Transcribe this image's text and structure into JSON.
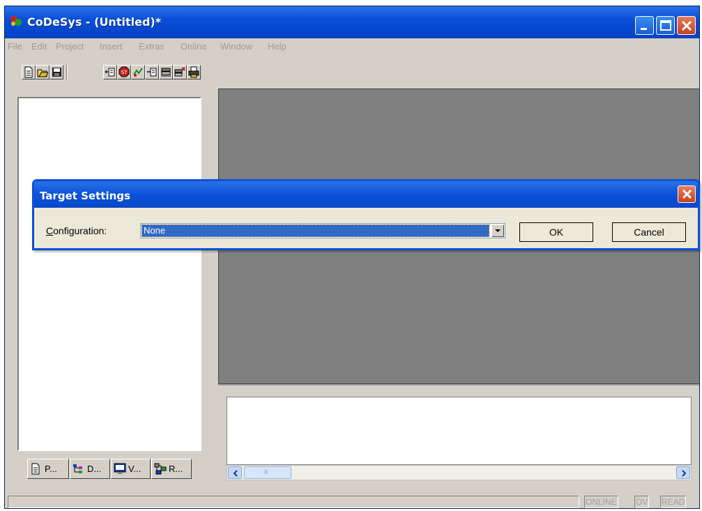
{
  "window": {
    "title": "CoDeSys - (Untitled)*"
  },
  "menu": [
    "File",
    "Edit",
    "Project",
    "Insert",
    "Extras",
    "Online",
    "Window",
    "Help"
  ],
  "toolbar": {
    "icons": [
      "new-icon",
      "open-icon",
      "save-icon",
      "login-icon",
      "stop-icon",
      "run-icon",
      "step-icon",
      "build-icon",
      "cross-icon",
      "print-icon"
    ]
  },
  "left_tabs": [
    {
      "label": "P...",
      "icon": "pou-icon"
    },
    {
      "label": "D...",
      "icon": "datatypes-icon"
    },
    {
      "label": "V...",
      "icon": "visualization-icon"
    },
    {
      "label": "R...",
      "icon": "resources-icon"
    }
  ],
  "status": {
    "online": "ONLINE",
    "ov": "OV",
    "read": "READ"
  },
  "dialog": {
    "title": "Target Settings",
    "config_label_u": "C",
    "config_label_rest": "onfiguration:",
    "config_value": "None",
    "ok_label": "OK",
    "cancel_label": "Cancel"
  },
  "scrollbar": {
    "thumb_grip": "III"
  }
}
